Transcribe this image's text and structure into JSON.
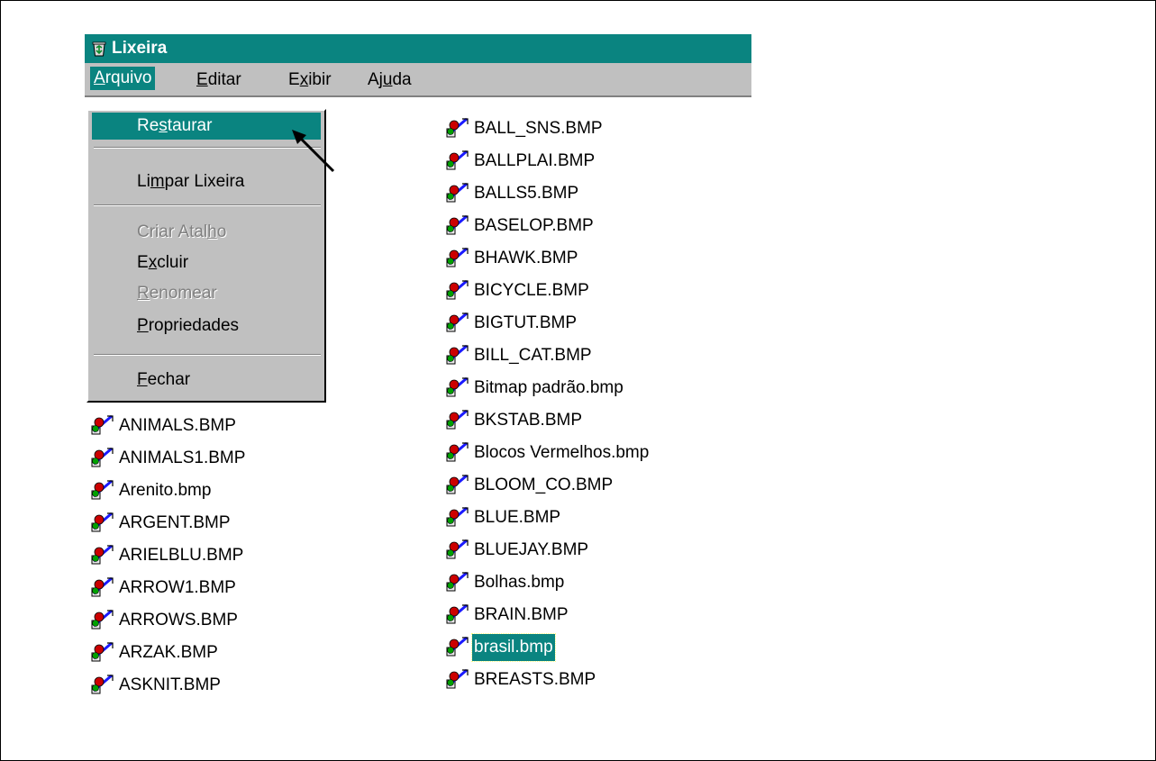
{
  "window": {
    "title": "Lixeira",
    "accent_color": "#0a8480",
    "icon": "recycle-bin-icon"
  },
  "menubar": {
    "items": [
      {
        "label": "Arquivo",
        "accel": "A"
      },
      {
        "label": "Editar",
        "accel": "E"
      },
      {
        "label": "Exibir",
        "accel": "x"
      },
      {
        "label": "Ajuda",
        "accel": "u"
      }
    ]
  },
  "file_menu": {
    "items": [
      {
        "label": "Restaurar",
        "state": "highlighted"
      },
      {
        "label": "Limpar Lixeira",
        "state": "enabled"
      },
      {
        "label": "Criar Atalho",
        "state": "disabled"
      },
      {
        "label": "Excluir",
        "state": "enabled"
      },
      {
        "label": "Renomear",
        "state": "disabled"
      },
      {
        "label": "Propriedades",
        "state": "enabled"
      },
      {
        "label": "Fechar",
        "state": "enabled"
      }
    ]
  },
  "files": {
    "left_column": [
      "ANIMALS.BMP",
      "ANIMALS1.BMP",
      "Arenito.bmp",
      "ARGENT.BMP",
      "ARIELBLU.BMP",
      "ARROW1.BMP",
      "ARROWS.BMP",
      "ARZAK.BMP",
      "ASKNIT.BMP"
    ],
    "right_column": [
      "BALL_SNS.BMP",
      "BALLPLAI.BMP",
      "BALLS5.BMP",
      "BASELOP.BMP",
      "BHAWK.BMP",
      "BICYCLE.BMP",
      "BIGTUT.BMP",
      "BILL_CAT.BMP",
      "Bitmap padrão.bmp",
      "BKSTAB.BMP",
      "Blocos Vermelhos.bmp",
      "BLOOM_CO.BMP",
      "BLUE.BMP",
      "BLUEJAY.BMP",
      "Bolhas.bmp",
      "BRAIN.BMP",
      "brasil.bmp",
      "BREASTS.BMP"
    ],
    "selected": "brasil.bmp",
    "icon": "bitmap-file-icon"
  }
}
